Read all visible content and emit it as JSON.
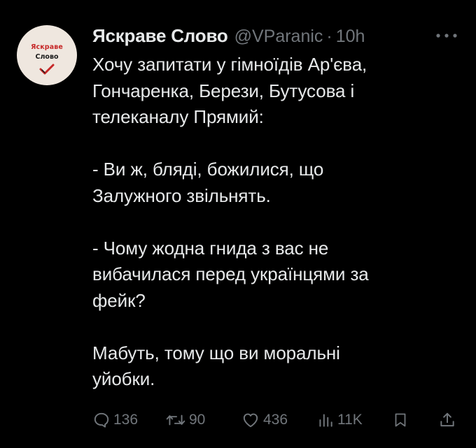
{
  "tweet": {
    "avatar": {
      "line1": "Яскраве",
      "line2": "Слово",
      "icon": "checkmark-icon"
    },
    "author": {
      "name": "Яскраве Слово",
      "handle": "@VParanic",
      "separator": "·",
      "time": "10h"
    },
    "text": "Хочу запитати у гімноїдів Ар'єва,\nГончаренка, Берези, Бутусова і\nтелеканалу Прямий:\n\n- Ви ж, бляді, божилися, що\nЗалужного звільнять.\n\n- Чому жодна гнида з вас не\nвибачилася перед українцями за\nфейк?\n\nМабуть, тому що ви моральні\nуйобки.",
    "stats": {
      "replies": "136",
      "retweets": "90",
      "likes": "436",
      "views": "11K"
    },
    "icons": {
      "more": "more-icon",
      "reply": "reply-icon",
      "retweet": "retweet-icon",
      "like": "heart-icon",
      "views": "views-icon",
      "bookmark": "bookmark-icon",
      "share": "share-icon"
    },
    "colors": {
      "background": "#000000",
      "text": "#e7e9ea",
      "muted": "#71767b",
      "avatar_bg": "#efe7df",
      "avatar_accent": "#c62828"
    }
  }
}
